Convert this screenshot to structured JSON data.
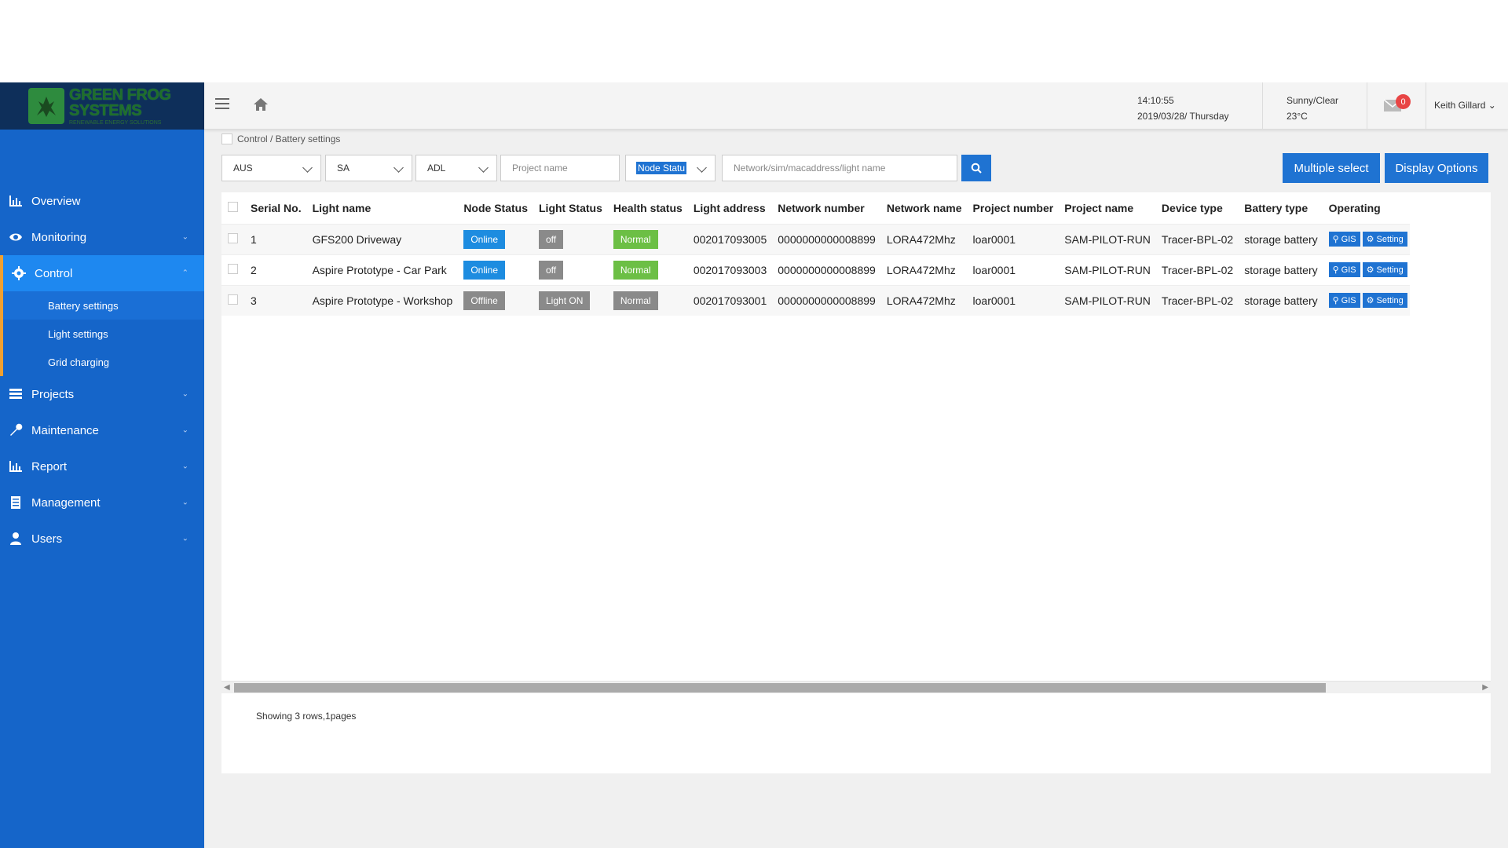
{
  "brand": {
    "line1": "GREEN FROG",
    "line2": "SYSTEMS",
    "tagline": "RENEWABLE ENERGY SOLUTIONS"
  },
  "colors": {
    "sidebar": "#1565c9",
    "sidebar_active": "#1e88f0",
    "accent_bar": "#f0a030",
    "primary": "#1f73d2",
    "online": "#1d8ce0",
    "offline": "#8a8a8a",
    "normal": "#6cbf45",
    "badge": "#e84545"
  },
  "sidebar": {
    "items": [
      {
        "label": "Overview",
        "icon": "bar-chart-icon"
      },
      {
        "label": "Monitoring",
        "icon": "eye-icon"
      },
      {
        "label": "Control",
        "icon": "gear-icon"
      },
      {
        "label": "Projects",
        "icon": "list-icon"
      },
      {
        "label": "Maintenance",
        "icon": "wrench-icon"
      },
      {
        "label": "Report",
        "icon": "bar-chart-icon"
      },
      {
        "label": "Management",
        "icon": "document-icon"
      },
      {
        "label": "Users",
        "icon": "user-icon"
      }
    ],
    "control_sub": [
      "Battery settings",
      "Light settings",
      "Grid charging"
    ]
  },
  "header": {
    "time": "14:10:55",
    "date": "2019/03/28/ Thursday",
    "weather": "Sunny/Clear",
    "temperature": "23°C",
    "notifications": "0",
    "user": "Keith Gillard"
  },
  "breadcrumb": "Control / Battery settings",
  "filters": {
    "country": "AUS",
    "state": "SA",
    "city": "ADL",
    "project_placeholder": "Project name",
    "node_status": "Node Statu",
    "search_placeholder": "Network/sim/macaddress/light name",
    "multiple_select": "Multiple select",
    "display_options": "Display Options"
  },
  "table": {
    "columns": [
      "Serial No.",
      "Light name",
      "Node Status",
      "Light Status",
      "Health status",
      "Light address",
      "Network number",
      "Network name",
      "Project number",
      "Project name",
      "Device type",
      "Battery type",
      "Operating"
    ],
    "rows": [
      {
        "serial": "1",
        "name": "GFS200 Driveway",
        "node": "Online",
        "light": "off",
        "health": "Normal",
        "address": "002017093005",
        "netnum": "0000000000008899",
        "netname": "LORA472Mhz",
        "projnum": "loar0001",
        "projname": "SAM-PILOT-RUN",
        "device": "Tracer-BPL-02",
        "battery": "storage battery"
      },
      {
        "serial": "2",
        "name": "Aspire Prototype - Car Park",
        "node": "Online",
        "light": "off",
        "health": "Normal",
        "address": "002017093003",
        "netnum": "0000000000008899",
        "netname": "LORA472Mhz",
        "projnum": "loar0001",
        "projname": "SAM-PILOT-RUN",
        "device": "Tracer-BPL-02",
        "battery": "storage battery"
      },
      {
        "serial": "3",
        "name": "Aspire Prototype - Workshop",
        "node": "Offline",
        "light": "Light ON",
        "health": "Normal",
        "address": "002017093001",
        "netnum": "0000000000008899",
        "netname": "LORA472Mhz",
        "projnum": "loar0001",
        "projname": "SAM-PILOT-RUN",
        "device": "Tracer-BPL-02",
        "battery": "storage battery"
      }
    ],
    "op_gis": "GIS",
    "op_setting": "Setting"
  },
  "pagination": "Showing 3 rows,1pages"
}
